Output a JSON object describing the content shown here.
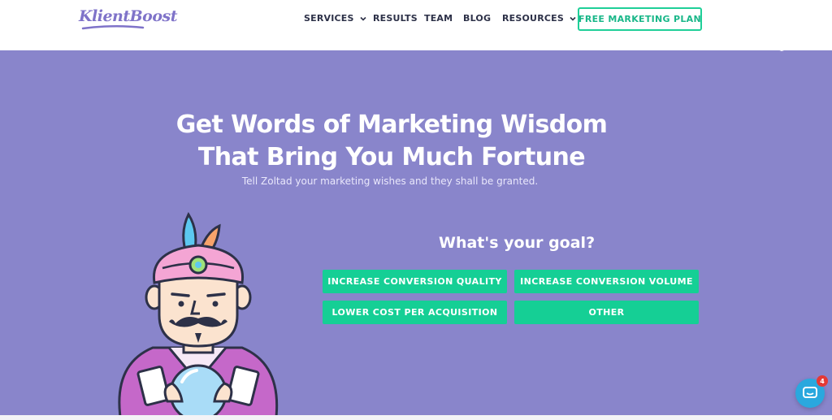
{
  "brand": {
    "logo_text": "KlientBoost"
  },
  "nav": {
    "items": [
      {
        "label": "SERVICES",
        "has_dropdown": true
      },
      {
        "label": "RESULTS",
        "has_dropdown": false
      },
      {
        "label": "TEAM",
        "has_dropdown": false
      },
      {
        "label": "BLOG",
        "has_dropdown": false
      },
      {
        "label": "RESOURCES",
        "has_dropdown": true
      }
    ],
    "cta_label": "FREE MARKETING PLAN"
  },
  "hero": {
    "headline_line1": "Get Words of Marketing Wisdom",
    "headline_line2": "That Bring You Much Fortune",
    "subheadline": "Tell Zoltad your marketing wishes and they shall be granted.",
    "goal_prompt": "What's your goal?",
    "options": [
      "INCREASE CONVERSION QUALITY",
      "INCREASE CONVERSION VOLUME",
      "LOWER COST PER ACQUISITION",
      "OTHER"
    ]
  },
  "chat": {
    "badge_count": "4"
  },
  "colors": {
    "hero_bg": "#8985cb",
    "accent_green": "#15cf95",
    "brand_purple": "#7f73c9",
    "nav_text": "#2d3148",
    "chat_blue": "#2aa8de",
    "badge_red": "#e53935"
  },
  "icons": [
    "chevron-down-icon",
    "fortune-teller-illustration",
    "chat-icon"
  ]
}
